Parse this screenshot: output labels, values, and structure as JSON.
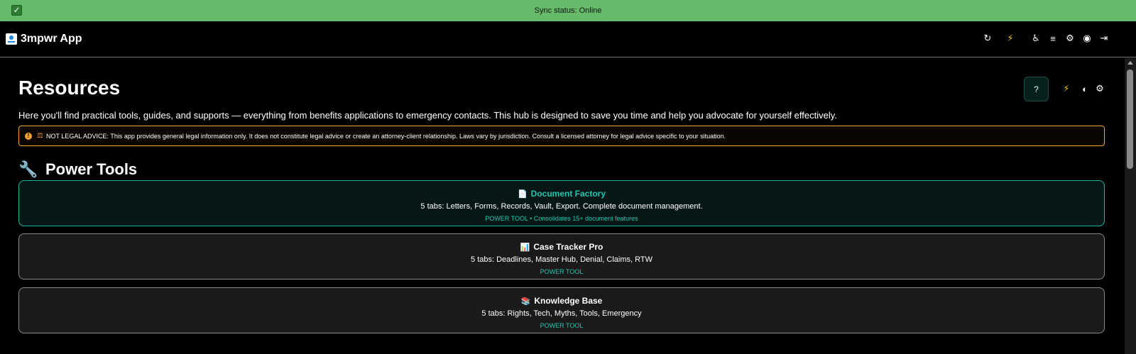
{
  "sync_bar": {
    "status_text": "Sync status: Online",
    "check_glyph": "✓",
    "color": "#66bb6a"
  },
  "header": {
    "app_title": "3mpwr App",
    "icons": [
      {
        "name": "refresh-icon",
        "glyph": "↻"
      },
      {
        "name": "bolt-icon",
        "glyph": "⚡"
      },
      {
        "name": "accessibility-icon",
        "glyph": "♿"
      },
      {
        "name": "menu-icon",
        "glyph": "≡"
      },
      {
        "name": "settings-icon",
        "glyph": "⚙"
      },
      {
        "name": "account-icon",
        "glyph": "◉"
      },
      {
        "name": "logout-icon",
        "glyph": "⇥"
      }
    ]
  },
  "page": {
    "title": "Resources",
    "help_label": "?",
    "intro": "Here you'll find practical tools, guides, and supports — everything from benefits applications to emergency contacts. This hub is designed to save you time and help you advocate for yourself effectively.",
    "disclaimer": "NOT LEGAL ADVICE: This app provides general legal information only. It does not constitute legal advice or create an attorney-client relationship. Laws vary by jurisdiction. Consult a licensed attorney for legal advice specific to your situation.",
    "toolbar_icons": [
      {
        "name": "bolt-icon",
        "glyph": "⚡"
      },
      {
        "name": "contrast-icon",
        "glyph": "◐"
      },
      {
        "name": "settings-icon",
        "glyph": "⚙"
      }
    ]
  },
  "power_tools": {
    "section_title": "Power Tools",
    "cards": [
      {
        "icon": "📄",
        "title": "Document Factory",
        "description": "5 tabs: Letters, Forms, Records, Vault, Export. Complete document management.",
        "badge": "POWER TOOL • Consolidates 15+ document features"
      },
      {
        "icon": "📊",
        "title": "Case Tracker Pro",
        "description": "5 tabs: Deadlines, Master Hub, Denial, Claims, RTW",
        "badge": "POWER TOOL"
      },
      {
        "icon": "📚",
        "title": "Knowledge Base",
        "description": "5 tabs: Rights, Tech, Myths, Tools, Emergency",
        "badge": "POWER TOOL"
      }
    ]
  },
  "colors": {
    "accent": "#1fc7b0",
    "warning": "#f0a038",
    "bolt": "#f5c518"
  }
}
